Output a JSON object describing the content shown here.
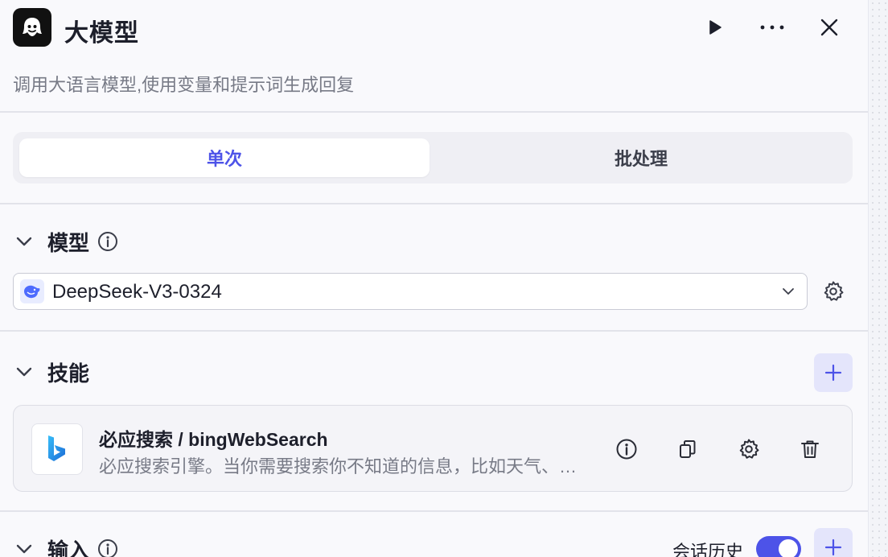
{
  "header": {
    "title": "大模型",
    "description": "调用大语言模型,使用变量和提示词生成回复"
  },
  "tabs": [
    {
      "label": "单次",
      "active": true
    },
    {
      "label": "批处理",
      "active": false
    }
  ],
  "model_section": {
    "title": "模型",
    "selected_model": "DeepSeek-V3-0324"
  },
  "skills_section": {
    "title": "技能",
    "skills": [
      {
        "name": "必应搜索 / bingWebSearch",
        "description": "必应搜索引擎。当你需要搜索你不知道的信息，比如天气、汇率、时事等，这个工具非常有用。"
      }
    ]
  },
  "input_section": {
    "title": "输入",
    "history_label": "会话历史",
    "history_enabled": true
  },
  "colors": {
    "accent": "#4d53e8",
    "accent_light": "#e4e5fb"
  }
}
